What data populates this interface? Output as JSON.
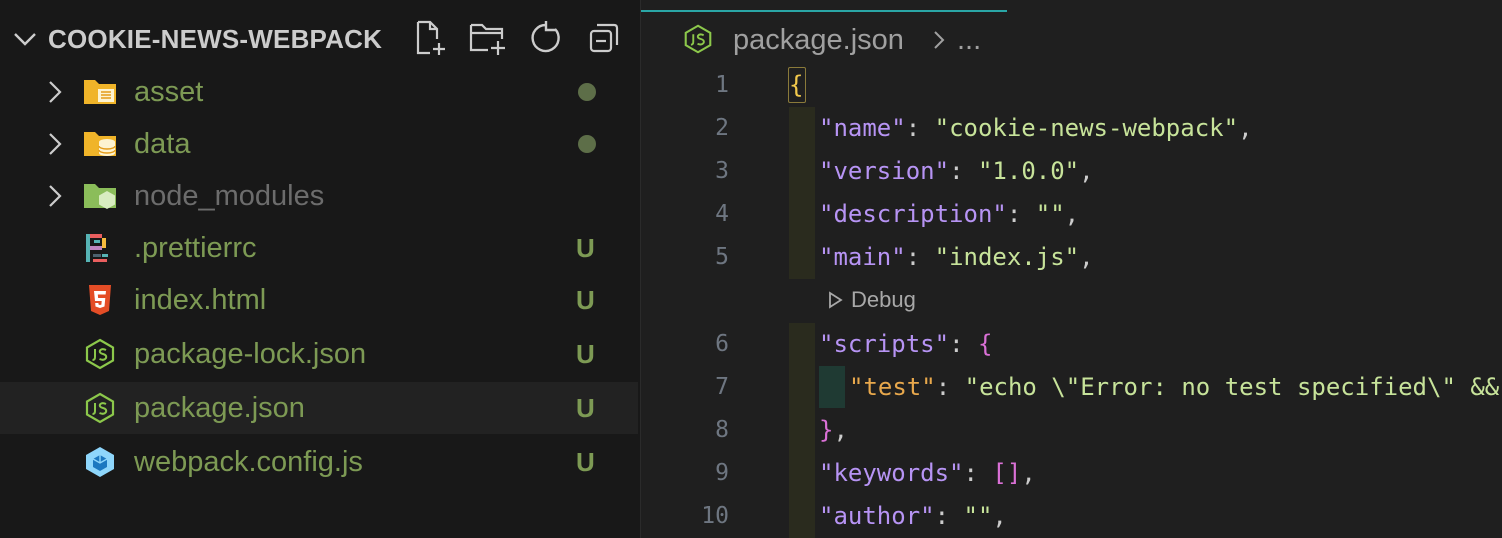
{
  "explorer": {
    "root_title": "COOKIE-NEWS-WEBPACK",
    "actions": [
      {
        "name": "new-file-icon"
      },
      {
        "name": "new-folder-icon"
      },
      {
        "name": "refresh-icon"
      },
      {
        "name": "collapse-all-icon"
      }
    ],
    "items": [
      {
        "label": "asset",
        "type": "folder",
        "icon": "folder-asset-icon",
        "status": "modified-dot"
      },
      {
        "label": "data",
        "type": "folder",
        "icon": "folder-data-icon",
        "status": "modified-dot"
      },
      {
        "label": "node_modules",
        "type": "folder",
        "icon": "folder-node-icon",
        "status": "",
        "ignored": true
      },
      {
        "label": ".prettierrc",
        "type": "file",
        "icon": "prettier-icon",
        "status": "U"
      },
      {
        "label": "index.html",
        "type": "file",
        "icon": "html5-icon",
        "status": "U"
      },
      {
        "label": "package-lock.json",
        "type": "file",
        "icon": "nodejs-icon",
        "status": "U"
      },
      {
        "label": "package.json",
        "type": "file",
        "icon": "nodejs-icon",
        "status": "U",
        "selected": true
      },
      {
        "label": "webpack.config.js",
        "type": "file",
        "icon": "webpack-icon",
        "status": "U"
      }
    ]
  },
  "editor": {
    "breadcrumb": {
      "file": "package.json",
      "ellipsis": "..."
    },
    "code_lens": "Debug",
    "lines": [
      {
        "n": "1",
        "key": "",
        "value": ""
      },
      {
        "n": "2",
        "key": "name",
        "value": "cookie-news-webpack"
      },
      {
        "n": "3",
        "key": "version",
        "value": "1.0.0"
      },
      {
        "n": "4",
        "key": "description",
        "value": ""
      },
      {
        "n": "5",
        "key": "main",
        "value": "index.js"
      },
      {
        "n": "6",
        "key": "scripts",
        "value": ""
      },
      {
        "n": "7",
        "key": "test",
        "value": "echo \\\"Error: no test specified\\\" &&"
      },
      {
        "n": "8",
        "key": "",
        "value": ""
      },
      {
        "n": "9",
        "key": "keywords",
        "value": ""
      },
      {
        "n": "10",
        "key": "author",
        "value": ""
      }
    ]
  },
  "colors": {
    "sidebar_bg": "#181818",
    "editor_bg": "#1f1f1f",
    "untracked_green": "#7d9a54",
    "json_key": "#b794f4",
    "json_string": "#c7e39a",
    "tab_accent": "#2aa6a6"
  }
}
